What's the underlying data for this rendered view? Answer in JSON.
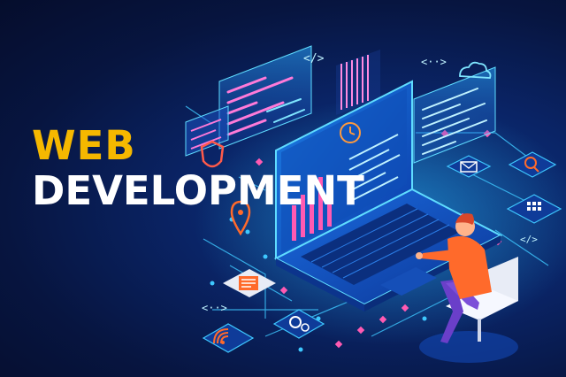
{
  "headline": {
    "line1": "WEB",
    "line2": "DEVELOPMENT"
  },
  "colors": {
    "background": "#071540",
    "accent_yellow": "#f5b800",
    "text_white": "#ffffff",
    "cyan_glow": "#29c8ff",
    "magenta": "#d94cff",
    "person_shirt": "#ff6a2b",
    "person_pants": "#6a3fc9"
  },
  "illustration": {
    "icons": [
      "code-brackets-icon",
      "shield-icon",
      "map-pin-icon",
      "cloud-icon",
      "clock-icon",
      "mail-icon",
      "search-icon",
      "grid-app-icon",
      "document-icon",
      "gear-icon",
      "wifi-signal-icon",
      "share-arrows-icon"
    ]
  }
}
